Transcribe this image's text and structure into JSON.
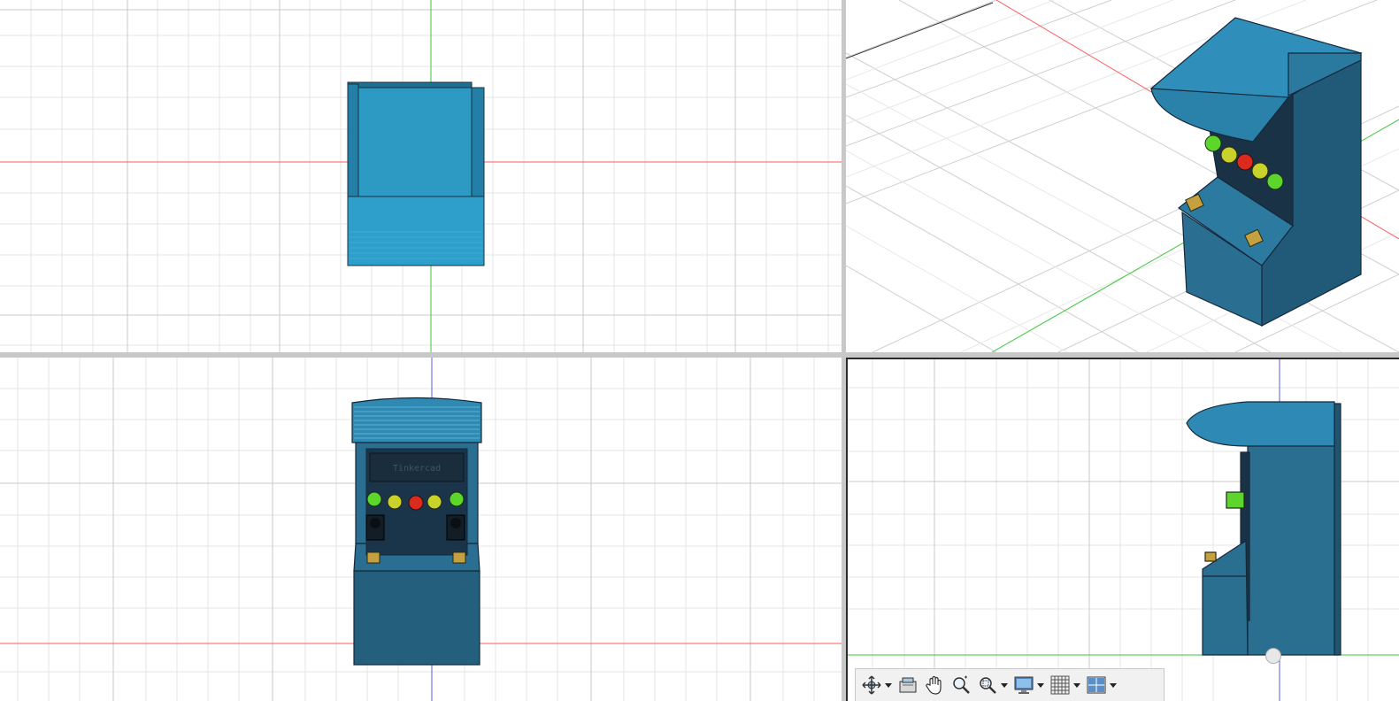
{
  "views": [
    {
      "id": "top",
      "cabinet_color": "#2b97c0"
    },
    {
      "id": "perspective",
      "cabinet_color": "#2a6f91"
    },
    {
      "id": "front",
      "marquee_text": "Tinkercad",
      "cabinet_color": "#245f7d"
    },
    {
      "id": "right",
      "cabinet_color": "#2a6e90"
    }
  ],
  "colors": {
    "grid": "#e2e2e2",
    "grid_major": "#c8c8c8",
    "axis_x": "#ff4a4a",
    "axis_y": "#39c43a",
    "axis_z": "#5b5be0",
    "button_green": "#5cd62a",
    "button_yellow": "#c9d22a",
    "button_red": "#dd2a1e"
  },
  "toolbar": {
    "tools": [
      {
        "name": "orbit-icon",
        "has_dropdown": true
      },
      {
        "name": "look-at-icon",
        "has_dropdown": false
      },
      {
        "name": "pan-icon",
        "has_dropdown": false
      },
      {
        "name": "zoom-icon",
        "has_dropdown": false
      },
      {
        "name": "zoom-window-icon",
        "has_dropdown": true
      },
      {
        "name": "display-settings-icon",
        "has_dropdown": true
      },
      {
        "name": "grid-settings-icon",
        "has_dropdown": true
      },
      {
        "name": "viewports-icon",
        "has_dropdown": true
      }
    ]
  }
}
